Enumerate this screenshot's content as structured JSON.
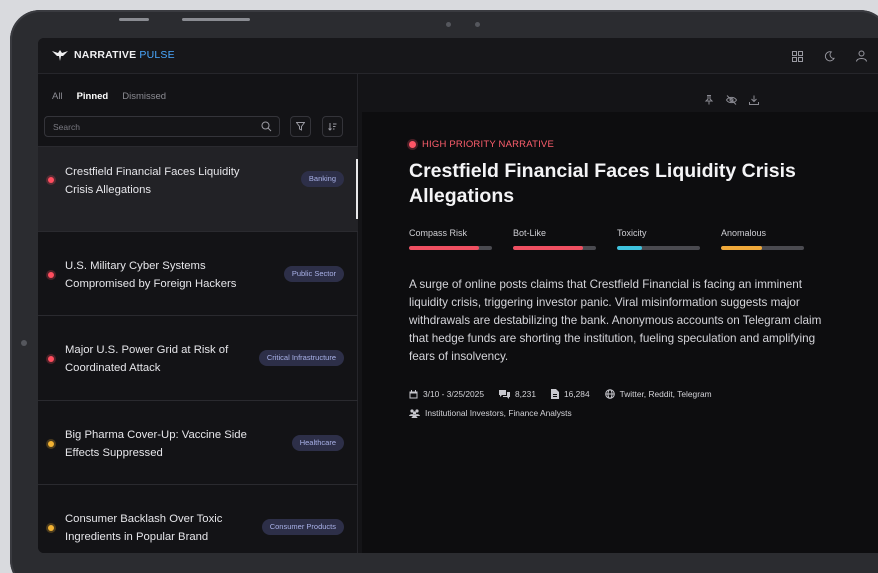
{
  "brand": {
    "name": "NARRATIVE",
    "accent": "PULSE",
    "accent_color": "#4aa8ff"
  },
  "header": {
    "icons": [
      "grid-icon",
      "moon-icon",
      "user-icon"
    ]
  },
  "tabs": [
    {
      "label": "All",
      "active": false
    },
    {
      "label": "Pinned",
      "active": true
    },
    {
      "label": "Dismissed",
      "active": false
    }
  ],
  "search": {
    "placeholder": "Search"
  },
  "narratives": [
    {
      "title": "Crestfield Financial Faces Liquidity Crisis Allegations",
      "tag": "Banking",
      "priority_color": "#ff4d5e",
      "active": true
    },
    {
      "title": "U.S. Military Cyber Systems Compromised by Foreign Hackers",
      "tag": "Public Sector",
      "priority_color": "#ff4d5e",
      "active": false
    },
    {
      "title": "Major U.S. Power Grid at Risk of Coordinated Attack",
      "tag": "Critical Infrastructure",
      "priority_color": "#ff4d5e",
      "active": false
    },
    {
      "title": "Big Pharma Cover-Up: Vaccine Side Effects Suppressed",
      "tag": "Healthcare",
      "priority_color": "#f2b233",
      "active": false
    },
    {
      "title": "Consumer Backlash Over Toxic Ingredients in Popular Brand",
      "tag": "Consumer Products",
      "priority_color": "#f2b233",
      "active": false
    }
  ],
  "detail": {
    "priority_label": "HIGH PRIORITY NARRATIVE",
    "title": "Crestfield Financial Faces Liquidity Crisis Allegations",
    "metrics": [
      {
        "label": "Compass Risk",
        "value": 0.84,
        "color": "#ef4f61"
      },
      {
        "label": "Bot-Like",
        "value": 0.84,
        "color": "#ef4f61"
      },
      {
        "label": "Toxicity",
        "value": 0.3,
        "color": "#3ec3de"
      },
      {
        "label": "Anomalous",
        "value": 0.49,
        "color": "#f0a93a"
      }
    ],
    "description": "A surge of online posts claims that Crestfield Financial is facing an imminent liquidity crisis, triggering investor panic. Viral misinformation suggests major withdrawals are destabilizing the bank. Anonymous accounts on Telegram claim that hedge funds are shorting the institution, fueling speculation and amplifying fears of insolvency.",
    "date_range": "3/10 - 3/25/2025",
    "comments": "8,231",
    "documents": "16,284",
    "platforms": "Twitter, Reddit, Telegram",
    "audiences": "Institutional Investors, Finance Analysts"
  }
}
